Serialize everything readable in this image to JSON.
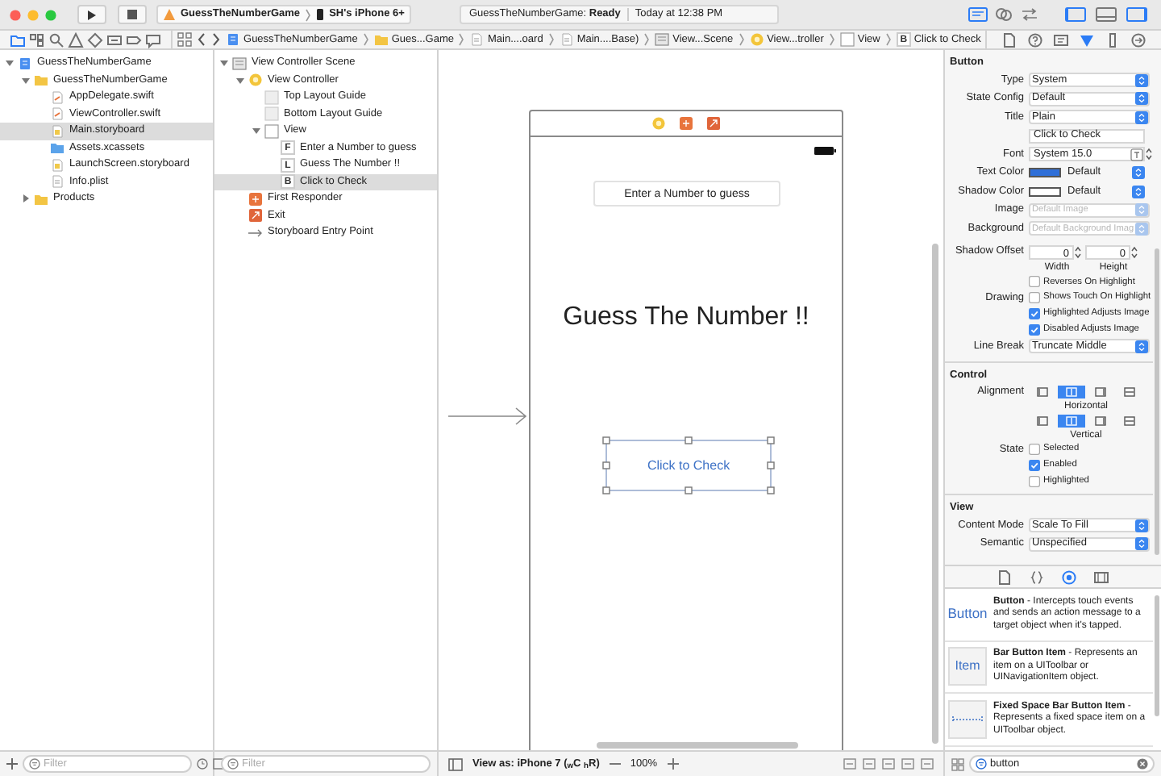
{
  "window": {
    "scheme": "GuessTheNumberGame",
    "device": "SH's iPhone 6+",
    "status": "GuessTheNumberGame: **Ready**",
    "time": "Today at 12:38 PM"
  },
  "editor_modes": [
    {
      "kind": "standard",
      "selected": true
    },
    {
      "kind": "assistant",
      "selected": false
    },
    {
      "kind": "version",
      "selected": false
    }
  ],
  "panels": [
    {
      "kind": "navigator",
      "on": true
    },
    {
      "kind": "debug",
      "on": false
    },
    {
      "kind": "utilities",
      "on": true
    }
  ],
  "navigator_tabs": [
    {
      "kind": "folder",
      "selected": true
    },
    {
      "kind": "symbol",
      "selected": false
    },
    {
      "kind": "search",
      "selected": false
    },
    {
      "kind": "warning",
      "selected": false
    },
    {
      "kind": "test",
      "selected": false
    },
    {
      "kind": "debug",
      "selected": false
    },
    {
      "kind": "breakpoint",
      "selected": false
    },
    {
      "kind": "report",
      "selected": false
    }
  ],
  "jump_bar": [
    {
      "kind": "project",
      "label": "GuessTheNumberGame"
    },
    {
      "kind": "folder",
      "label": "Gues...Game"
    },
    {
      "kind": "storyboard",
      "label": "Main....oard"
    },
    {
      "kind": "storyboard",
      "label": "Main....Base)"
    },
    {
      "kind": "scene",
      "label": "View...Scene"
    },
    {
      "kind": "controller",
      "label": "View...troller"
    },
    {
      "kind": "view",
      "label": "View"
    },
    {
      "kind": "control",
      "glyph": "B",
      "label": "Click to Check"
    }
  ],
  "inspector_tabs": [
    {
      "kind": "file",
      "selected": false
    },
    {
      "kind": "help",
      "selected": false
    },
    {
      "kind": "identity",
      "selected": false
    },
    {
      "kind": "attributes",
      "selected": true
    },
    {
      "kind": "size",
      "selected": false
    },
    {
      "kind": "connections",
      "selected": false
    }
  ],
  "navigator": {
    "items": [
      {
        "label": "GuessTheNumberGame",
        "kind": "project",
        "expanded": true,
        "selected": false,
        "children": [
          {
            "label": "GuessTheNumberGame",
            "kind": "folder",
            "expanded": true,
            "selected": false,
            "children": [
              {
                "label": "AppDelegate.swift",
                "kind": "swift",
                "selected": false
              },
              {
                "label": "ViewController.swift",
                "kind": "swift",
                "selected": false
              },
              {
                "label": "Main.storyboard",
                "kind": "storyboard",
                "selected": true
              },
              {
                "label": "Assets.xcassets",
                "kind": "assets",
                "selected": false
              },
              {
                "label": "LaunchScreen.storyboard",
                "kind": "storyboard",
                "selected": false
              },
              {
                "label": "Info.plist",
                "kind": "plist",
                "selected": false
              }
            ]
          },
          {
            "label": "Products",
            "kind": "folder",
            "expanded": false,
            "selected": false
          }
        ]
      }
    ]
  },
  "outline": {
    "items": [
      {
        "label": "View Controller Scene",
        "kind": "scene",
        "expanded": true,
        "selected": false,
        "children": [
          {
            "label": "View Controller",
            "kind": "controller",
            "expanded": true,
            "selected": false,
            "children": [
              {
                "label": "Top Layout Guide",
                "kind": "guide",
                "selected": false
              },
              {
                "label": "Bottom Layout Guide",
                "kind": "guide",
                "selected": false
              },
              {
                "label": "View",
                "kind": "view",
                "expanded": true,
                "selected": false,
                "children": [
                  {
                    "label": "Enter a Number to guess",
                    "kind": "control",
                    "glyph": "F",
                    "selected": false
                  },
                  {
                    "label": "Guess The Number !!",
                    "kind": "control",
                    "glyph": "L",
                    "selected": false
                  },
                  {
                    "label": "Click to Check",
                    "kind": "control",
                    "glyph": "B",
                    "selected": true
                  }
                ]
              }
            ]
          },
          {
            "label": "First Responder",
            "kind": "responder",
            "selected": false
          },
          {
            "label": "Exit",
            "kind": "exit",
            "selected": false
          },
          {
            "label": "Storyboard Entry Point",
            "kind": "entry",
            "selected": false
          }
        ]
      }
    ]
  },
  "canvas": {
    "field_placeholder": "Enter a Number to guess",
    "title": "Guess The Number !!",
    "button": {
      "label": "Click to Check",
      "selected": true
    }
  },
  "inspector": {
    "sections": [
      {
        "title": "Button",
        "rows": [
          {
            "kind": "popup",
            "label": "Type",
            "value": "System",
            "disabled": false
          },
          {
            "kind": "popup",
            "label": "State Config",
            "value": "Default",
            "disabled": false
          },
          {
            "kind": "popup",
            "label": "Title",
            "value": "Plain",
            "disabled": false
          },
          {
            "kind": "text",
            "value": "Click to Check"
          },
          {
            "kind": "font",
            "label": "Font",
            "value": "System 15.0"
          },
          {
            "kind": "color",
            "label": "Text Color",
            "color": "#2f6fd8",
            "value": "Default"
          },
          {
            "kind": "color",
            "label": "Shadow Color",
            "color": "#ffffff",
            "value": "Default"
          },
          {
            "kind": "popup",
            "label": "Image",
            "placeholder": "Default Image",
            "disabled": true
          },
          {
            "kind": "popup",
            "label": "Background",
            "placeholder": "Default Background Imag",
            "disabled": true
          },
          {
            "kind": "offset",
            "label": "Shadow Offset",
            "fields": [
              {
                "value": "0",
                "caption": "Width"
              },
              {
                "value": "0",
                "caption": "Height"
              }
            ]
          },
          {
            "kind": "check",
            "text": "Reverses On Highlight",
            "checked": false
          },
          {
            "kind": "check",
            "label": "Drawing",
            "text": "Shows Touch On Highlight",
            "checked": false
          },
          {
            "kind": "check",
            "text": "Highlighted Adjusts Image",
            "checked": true
          },
          {
            "kind": "check",
            "text": "Disabled Adjusts Image",
            "checked": true
          },
          {
            "kind": "popup",
            "label": "Line Break",
            "value": "Truncate Middle",
            "disabled": false
          }
        ]
      },
      {
        "title": "Control",
        "rows": [
          {
            "kind": "segments",
            "label": "Alignment",
            "caption": "Horizontal",
            "segments": [
              {
                "selected": false
              },
              {
                "selected": true
              },
              {
                "selected": false
              },
              {
                "selected": false
              }
            ]
          },
          {
            "kind": "segments",
            "caption": "Vertical",
            "segments": [
              {
                "selected": false
              },
              {
                "selected": true
              },
              {
                "selected": false
              },
              {
                "selected": false
              }
            ]
          },
          {
            "kind": "check",
            "label": "State",
            "text": "Selected",
            "checked": false
          },
          {
            "kind": "check",
            "text": "Enabled",
            "checked": true
          },
          {
            "kind": "check",
            "text": "Highlighted",
            "checked": false
          }
        ]
      },
      {
        "title": "View",
        "rows": [
          {
            "kind": "popup",
            "label": "Content Mode",
            "value": "Scale To Fill",
            "disabled": false
          },
          {
            "kind": "popup",
            "label": "Semantic",
            "value": "Unspecified",
            "disabled": false
          }
        ]
      }
    ]
  },
  "library": {
    "tabs": [
      {
        "kind": "file",
        "selected": false
      },
      {
        "kind": "braces",
        "selected": false
      },
      {
        "kind": "object",
        "selected": true
      },
      {
        "kind": "media",
        "selected": false
      }
    ],
    "items": [
      {
        "kind": "text",
        "preview": "Button",
        "text": "**Button** - Intercepts touch events and sends an action message to a target object when it's tapped."
      },
      {
        "kind": "boxed",
        "preview": "Item",
        "text": "**Bar Button Item** - Represents an item on a UIToolbar or UINavigationItem object."
      },
      {
        "kind": "spacer",
        "text": "**Fixed Space Bar Button Item** - Represents a fixed space item on a UIToolbar object."
      }
    ],
    "search": "button"
  },
  "bottom": {
    "navigator_filter": {
      "placeholder": "Filter"
    },
    "outline_filter": {
      "placeholder": "Filter"
    },
    "view_as": "View as: iPhone 7 ($_{w}$C $_{h}$R)",
    "zoom": "100%"
  }
}
